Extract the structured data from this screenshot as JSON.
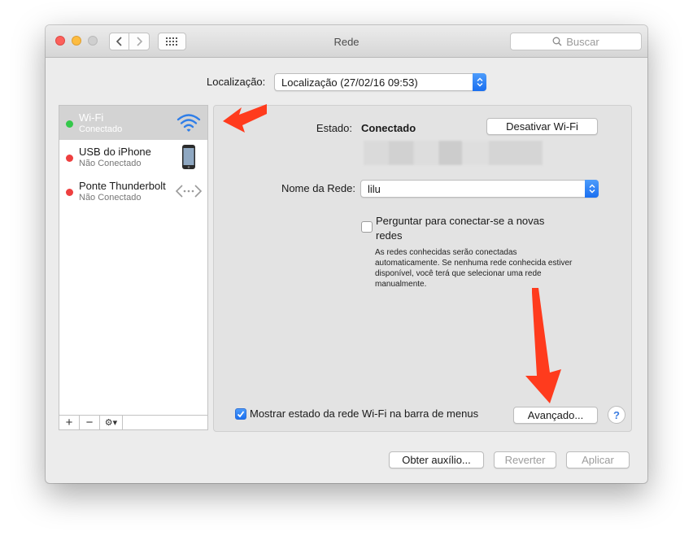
{
  "window": {
    "title": "Rede",
    "search_placeholder": "Buscar"
  },
  "location": {
    "label": "Localização:",
    "value": "Localização (27/02/16 09:53)"
  },
  "services": [
    {
      "name": "Wi-Fi",
      "status": "Conectado",
      "state": "connected",
      "icon": "wifi-icon"
    },
    {
      "name": "USB do iPhone",
      "status": "Não Conectado",
      "state": "disconnected",
      "icon": "iphone-icon"
    },
    {
      "name": "Ponte Thunderbolt",
      "status": "Não Conectado",
      "state": "disconnected",
      "icon": "thunderbolt-bridge-icon"
    }
  ],
  "sidebar_toolbar": {
    "add": "+",
    "remove": "−",
    "gear": "⚙▾"
  },
  "detail": {
    "status_label": "Estado:",
    "status_value": "Conectado",
    "disable_button": "Desativar Wi-Fi",
    "network_label": "Nome da Rede:",
    "network_value": "lilu",
    "ask_checkbox_label": "Perguntar para conectar-se a novas redes",
    "ask_checked": false,
    "ask_note": "As redes conhecidas serão conectadas automaticamente. Se nenhuma rede conhecida estiver disponível, você terá que selecionar uma rede manualmente.",
    "show_checkbox_label": "Mostrar estado da rede Wi-Fi na barra de menus",
    "show_checked": true,
    "advanced_button": "Avançado...",
    "help_button": "?"
  },
  "footer": {
    "help_button": "Obter auxílio...",
    "revert_button": "Reverter",
    "apply_button": "Aplicar"
  },
  "colors": {
    "accent_blue": "#1a6ff0",
    "connected_green": "#34c84a",
    "disconnected_red": "#ee3f3f",
    "annotation_arrow": "#ff3b1d"
  }
}
